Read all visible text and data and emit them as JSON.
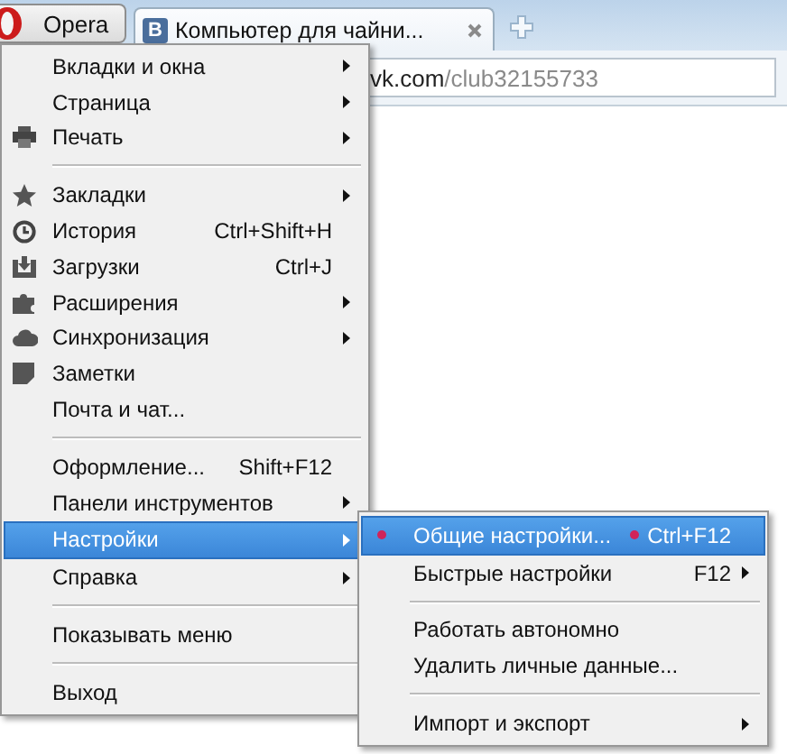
{
  "browser": {
    "menu_button": "Opera",
    "tab": {
      "title": "Компьютер для чайни...",
      "icon_letter": "B"
    },
    "address": {
      "domain": "vk.com",
      "path": "/club32155733"
    }
  },
  "menu": {
    "items": [
      {
        "kind": "item",
        "label": "Вкладки и окна",
        "arrow": true,
        "selected": false
      },
      {
        "kind": "item",
        "label": "Страница",
        "arrow": true,
        "selected": false
      },
      {
        "kind": "item",
        "label": "Печать",
        "arrow": true,
        "selected": false
      },
      {
        "kind": "separator"
      },
      {
        "kind": "item",
        "label": "Закладки",
        "arrow": true,
        "selected": false
      },
      {
        "kind": "item",
        "label": "История",
        "shortcut": "Ctrl+Shift+H",
        "arrow": false,
        "selected": false
      },
      {
        "kind": "item",
        "label": "Загрузки",
        "shortcut": "Ctrl+J",
        "arrow": false,
        "selected": false
      },
      {
        "kind": "item",
        "label": "Расширения",
        "arrow": true,
        "selected": false
      },
      {
        "kind": "item",
        "label": "Синхронизация",
        "arrow": true,
        "selected": false
      },
      {
        "kind": "item",
        "label": "Заметки",
        "arrow": false,
        "selected": false
      },
      {
        "kind": "item",
        "label": "Почта и чат...",
        "arrow": false,
        "selected": false
      },
      {
        "kind": "separator"
      },
      {
        "kind": "item",
        "label": "Оформление...",
        "shortcut": "Shift+F12",
        "arrow": false,
        "selected": false
      },
      {
        "kind": "item",
        "label": "Панели инструментов",
        "arrow": true,
        "selected": false
      },
      {
        "kind": "item",
        "label": "Настройки",
        "arrow": true,
        "selected": true
      },
      {
        "kind": "item",
        "label": "Справка",
        "arrow": true,
        "selected": false
      },
      {
        "kind": "separator"
      },
      {
        "kind": "item",
        "label": "Показывать меню",
        "arrow": false,
        "selected": false
      },
      {
        "kind": "separator"
      },
      {
        "kind": "item",
        "label": "Выход",
        "arrow": false,
        "selected": false
      }
    ]
  },
  "submenu": {
    "items": [
      {
        "kind": "item",
        "label": "Общие настройки...",
        "shortcut": "Ctrl+F12",
        "arrow": false,
        "selected": true,
        "marked": true
      },
      {
        "kind": "item",
        "label": "Быстрые настройки",
        "shortcut": "F12",
        "arrow": true,
        "selected": false,
        "marked": false
      },
      {
        "kind": "separator"
      },
      {
        "kind": "item",
        "label": "Работать автономно",
        "arrow": false,
        "selected": false,
        "marked": false
      },
      {
        "kind": "item",
        "label": "Удалить личные данные...",
        "arrow": false,
        "selected": false,
        "marked": false
      },
      {
        "kind": "separator"
      },
      {
        "kind": "item",
        "label": "Импорт и экспорт",
        "arrow": true,
        "selected": false,
        "marked": false
      }
    ]
  }
}
